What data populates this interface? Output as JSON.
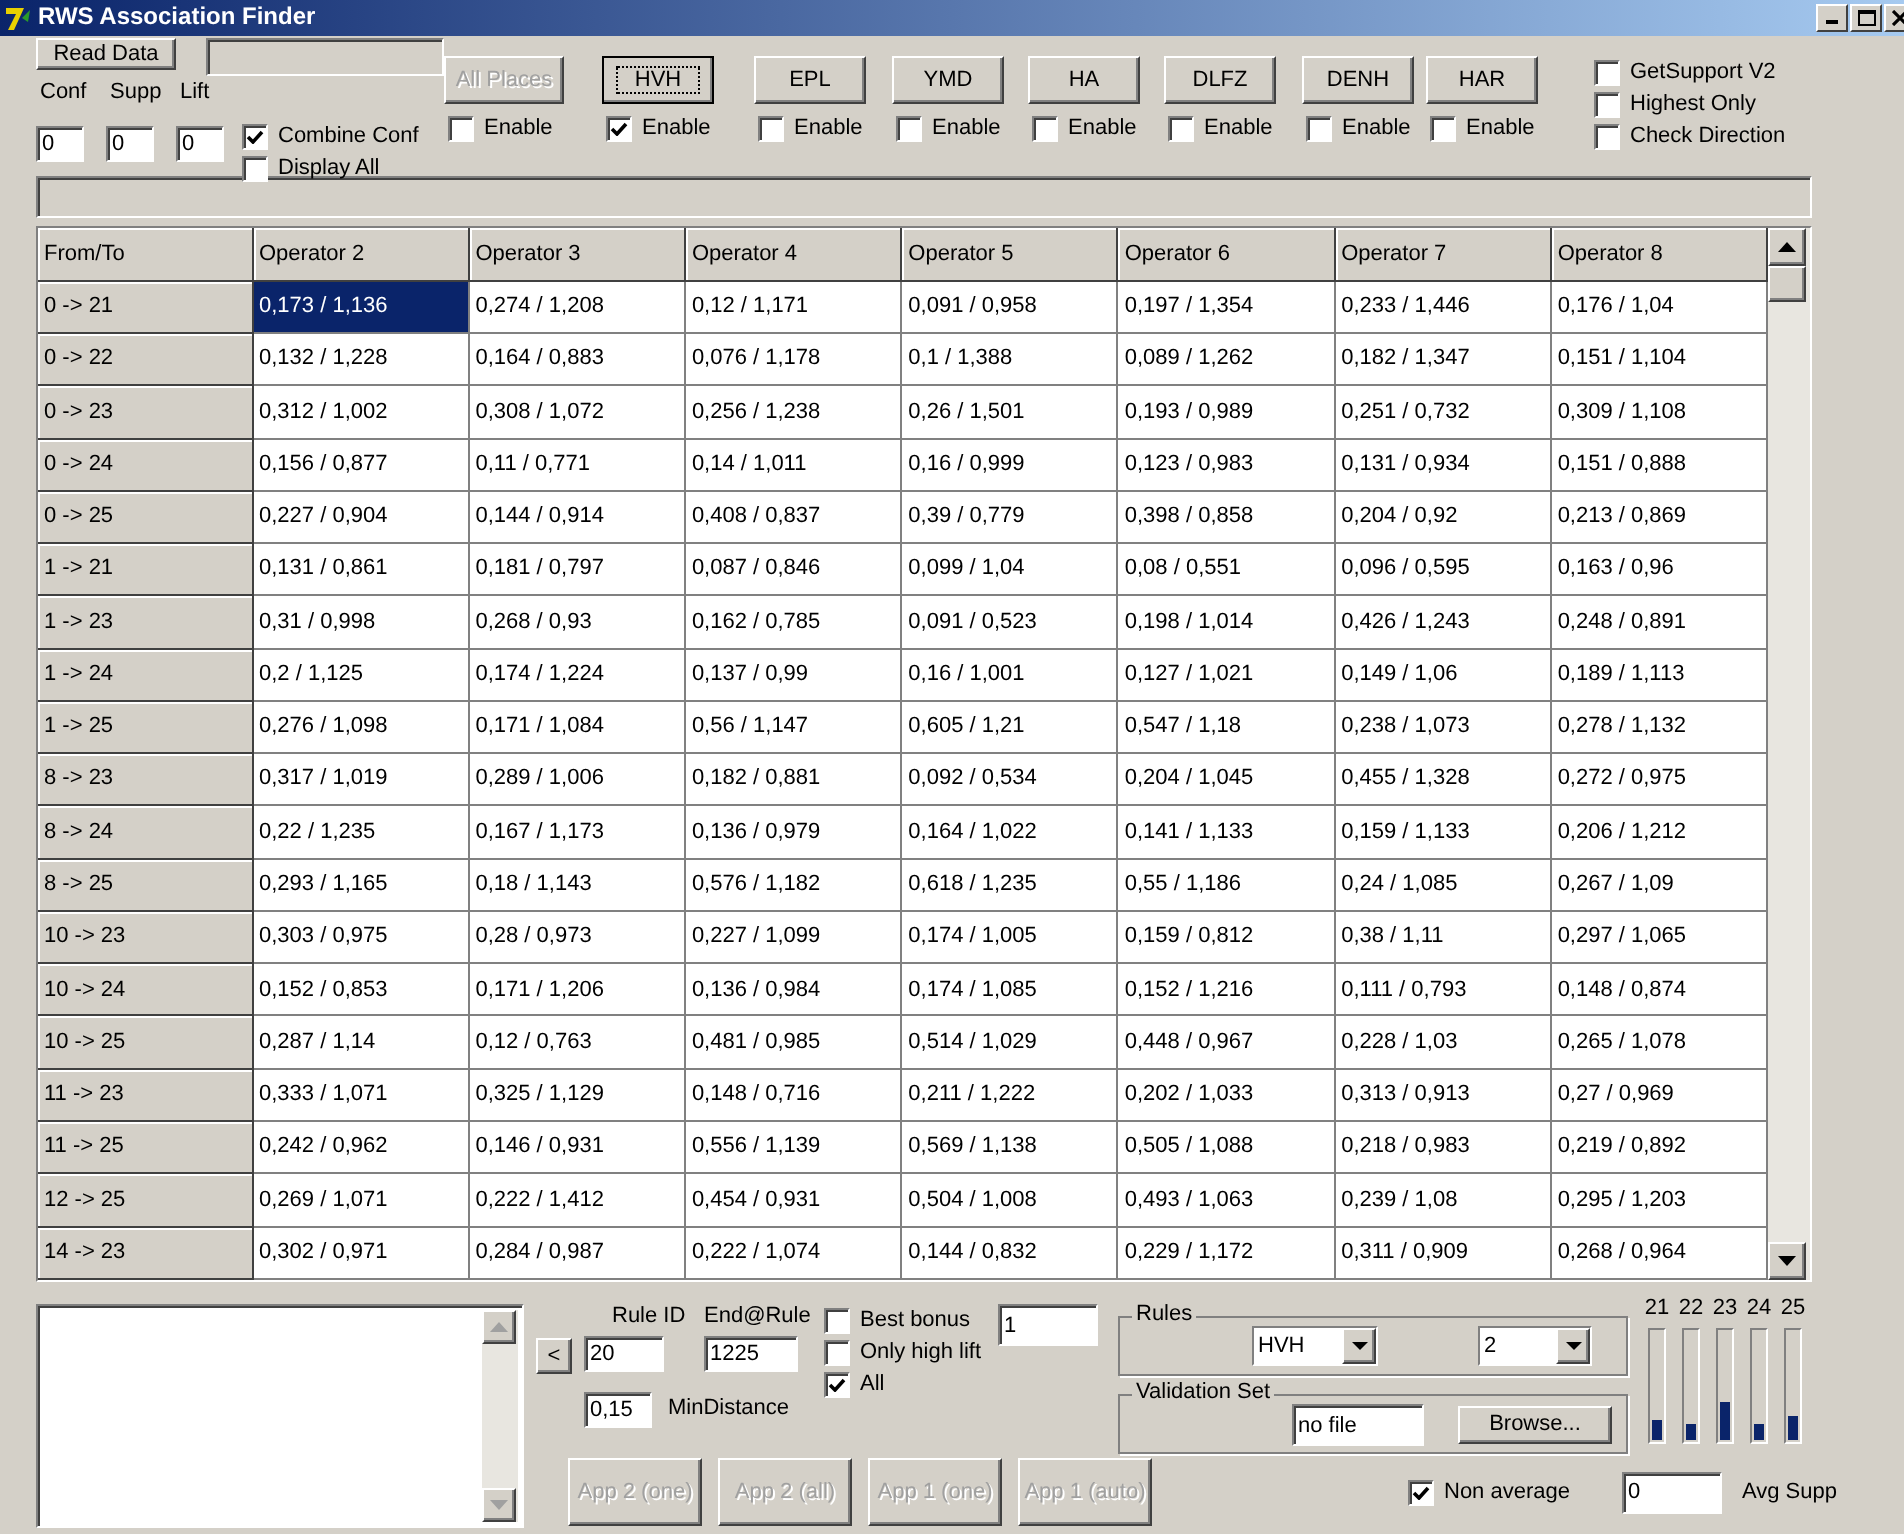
{
  "window": {
    "title": "RWS Association Finder"
  },
  "toolbar": {
    "read_button": "Read Data",
    "file_field": {
      "disabled": true
    },
    "thresholds": [
      {
        "label": "Conf",
        "value": "0"
      },
      {
        "label": "Supp",
        "value": "0"
      },
      {
        "label": "Lift",
        "value": "0"
      }
    ],
    "options": [
      {
        "label": "Combine Conf",
        "checked": true
      },
      {
        "label": "Display All",
        "checked": false
      }
    ],
    "places": [
      {
        "label": "All Places",
        "disabled": true,
        "focused": false,
        "enable_label": "Enable",
        "checked": false
      },
      {
        "label": "HVH",
        "disabled": false,
        "focused": true,
        "enable_label": "Enable",
        "checked": true
      },
      {
        "label": "EPL",
        "disabled": false,
        "focused": false,
        "enable_label": "Enable",
        "checked": false
      },
      {
        "label": "YMD",
        "disabled": false,
        "focused": false,
        "enable_label": "Enable",
        "checked": false
      },
      {
        "label": "HA",
        "disabled": false,
        "focused": false,
        "enable_label": "Enable",
        "checked": false
      },
      {
        "label": "DLFZ",
        "disabled": false,
        "focused": false,
        "enable_label": "Enable",
        "checked": false
      },
      {
        "label": "DENH",
        "disabled": false,
        "focused": false,
        "enable_label": "Enable",
        "checked": false
      },
      {
        "label": "HAR",
        "disabled": false,
        "focused": false,
        "enable_label": "Enable",
        "checked": false
      }
    ],
    "flags": [
      {
        "label": "GetSupport V2",
        "checked": false
      },
      {
        "label": "Highest Only",
        "checked": false
      },
      {
        "label": "Check Direction",
        "checked": false
      }
    ]
  },
  "table": {
    "row_header_title": "From/To",
    "columns": [
      "Operator 2",
      "Operator 3",
      "Operator 4",
      "Operator 5",
      "Operator 6",
      "Operator 7",
      "Operator 8"
    ],
    "rows": [
      {
        "head": "0 -> 21",
        "cells": [
          {
            "t": "0,173 / 1,136",
            "selected": true
          },
          {
            "t": "0,274 / 1,208",
            "selected": false
          },
          {
            "t": "0,12 / 1,171",
            "selected": false
          },
          {
            "t": "0,091 / 0,958",
            "selected": false
          },
          {
            "t": "0,197 / 1,354",
            "selected": false
          },
          {
            "t": "0,233 / 1,446",
            "selected": false
          },
          {
            "t": "0,176 / 1,04",
            "selected": false
          }
        ]
      },
      {
        "head": "0 -> 22",
        "cells": [
          {
            "t": "0,132 / 1,228",
            "selected": false
          },
          {
            "t": "0,164 / 0,883",
            "selected": false
          },
          {
            "t": "0,076 / 1,178",
            "selected": false
          },
          {
            "t": "0,1 / 1,388",
            "selected": false
          },
          {
            "t": "0,089 / 1,262",
            "selected": false
          },
          {
            "t": "0,182 / 1,347",
            "selected": false
          },
          {
            "t": "0,151 / 1,104",
            "selected": false
          }
        ]
      },
      {
        "head": "0 -> 23",
        "cells": [
          {
            "t": "0,312 / 1,002",
            "selected": false
          },
          {
            "t": "0,308 / 1,072",
            "selected": false
          },
          {
            "t": "0,256 / 1,238",
            "selected": false
          },
          {
            "t": "0,26 / 1,501",
            "selected": false
          },
          {
            "t": "0,193 / 0,989",
            "selected": false
          },
          {
            "t": "0,251 / 0,732",
            "selected": false
          },
          {
            "t": "0,309 / 1,108",
            "selected": false
          }
        ]
      },
      {
        "head": "0 -> 24",
        "cells": [
          {
            "t": "0,156 / 0,877",
            "selected": false
          },
          {
            "t": "0,11 / 0,771",
            "selected": false
          },
          {
            "t": "0,14 / 1,011",
            "selected": false
          },
          {
            "t": "0,16 / 0,999",
            "selected": false
          },
          {
            "t": "0,123 / 0,983",
            "selected": false
          },
          {
            "t": "0,131 / 0,934",
            "selected": false
          },
          {
            "t": "0,151 / 0,888",
            "selected": false
          }
        ]
      },
      {
        "head": "0 -> 25",
        "cells": [
          {
            "t": "0,227 / 0,904",
            "selected": false
          },
          {
            "t": "0,144 / 0,914",
            "selected": false
          },
          {
            "t": "0,408 / 0,837",
            "selected": false
          },
          {
            "t": "0,39 / 0,779",
            "selected": false
          },
          {
            "t": "0,398 / 0,858",
            "selected": false
          },
          {
            "t": "0,204 / 0,92",
            "selected": false
          },
          {
            "t": "0,213 / 0,869",
            "selected": false
          }
        ]
      },
      {
        "head": "1 -> 21",
        "cells": [
          {
            "t": "0,131 / 0,861",
            "selected": false
          },
          {
            "t": "0,181 / 0,797",
            "selected": false
          },
          {
            "t": "0,087 / 0,846",
            "selected": false
          },
          {
            "t": "0,099 / 1,04",
            "selected": false
          },
          {
            "t": "0,08 / 0,551",
            "selected": false
          },
          {
            "t": "0,096 / 0,595",
            "selected": false
          },
          {
            "t": "0,163 / 0,96",
            "selected": false
          }
        ]
      },
      {
        "head": "1 -> 23",
        "cells": [
          {
            "t": "0,31 / 0,998",
            "selected": false
          },
          {
            "t": "0,268 / 0,93",
            "selected": false
          },
          {
            "t": "0,162 / 0,785",
            "selected": false
          },
          {
            "t": "0,091 / 0,523",
            "selected": false
          },
          {
            "t": "0,198 / 1,014",
            "selected": false
          },
          {
            "t": "0,426 / 1,243",
            "selected": false
          },
          {
            "t": "0,248 / 0,891",
            "selected": false
          }
        ]
      },
      {
        "head": "1 -> 24",
        "cells": [
          {
            "t": "0,2 / 1,125",
            "selected": false
          },
          {
            "t": "0,174 / 1,224",
            "selected": false
          },
          {
            "t": "0,137 / 0,99",
            "selected": false
          },
          {
            "t": "0,16 / 1,001",
            "selected": false
          },
          {
            "t": "0,127 / 1,021",
            "selected": false
          },
          {
            "t": "0,149 / 1,06",
            "selected": false
          },
          {
            "t": "0,189 / 1,113",
            "selected": false
          }
        ]
      },
      {
        "head": "1 -> 25",
        "cells": [
          {
            "t": "0,276 / 1,098",
            "selected": false
          },
          {
            "t": "0,171 / 1,084",
            "selected": false
          },
          {
            "t": "0,56 / 1,147",
            "selected": false
          },
          {
            "t": "0,605 / 1,21",
            "selected": false
          },
          {
            "t": "0,547 / 1,18",
            "selected": false
          },
          {
            "t": "0,238 / 1,073",
            "selected": false
          },
          {
            "t": "0,278 / 1,132",
            "selected": false
          }
        ]
      },
      {
        "head": "8 -> 23",
        "cells": [
          {
            "t": "0,317 / 1,019",
            "selected": false
          },
          {
            "t": "0,289 / 1,006",
            "selected": false
          },
          {
            "t": "0,182 / 0,881",
            "selected": false
          },
          {
            "t": "0,092 / 0,534",
            "selected": false
          },
          {
            "t": "0,204 / 1,045",
            "selected": false
          },
          {
            "t": "0,455 / 1,328",
            "selected": false
          },
          {
            "t": "0,272 / 0,975",
            "selected": false
          }
        ]
      },
      {
        "head": "8 -> 24",
        "cells": [
          {
            "t": "0,22 / 1,235",
            "selected": false
          },
          {
            "t": "0,167 / 1,173",
            "selected": false
          },
          {
            "t": "0,136 / 0,979",
            "selected": false
          },
          {
            "t": "0,164 / 1,022",
            "selected": false
          },
          {
            "t": "0,141 / 1,133",
            "selected": false
          },
          {
            "t": "0,159 / 1,133",
            "selected": false
          },
          {
            "t": "0,206 / 1,212",
            "selected": false
          }
        ]
      },
      {
        "head": "8 -> 25",
        "cells": [
          {
            "t": "0,293 / 1,165",
            "selected": false
          },
          {
            "t": "0,18 / 1,143",
            "selected": false
          },
          {
            "t": "0,576 / 1,182",
            "selected": false
          },
          {
            "t": "0,618 / 1,235",
            "selected": false
          },
          {
            "t": "0,55 / 1,186",
            "selected": false
          },
          {
            "t": "0,24 / 1,085",
            "selected": false
          },
          {
            "t": "0,267 / 1,09",
            "selected": false
          }
        ]
      },
      {
        "head": "10 -> 23",
        "cells": [
          {
            "t": "0,303 / 0,975",
            "selected": false
          },
          {
            "t": "0,28 / 0,973",
            "selected": false
          },
          {
            "t": "0,227 / 1,099",
            "selected": false
          },
          {
            "t": "0,174 / 1,005",
            "selected": false
          },
          {
            "t": "0,159 / 0,812",
            "selected": false
          },
          {
            "t": "0,38 / 1,11",
            "selected": false
          },
          {
            "t": "0,297 / 1,065",
            "selected": false
          }
        ]
      },
      {
        "head": "10 -> 24",
        "cells": [
          {
            "t": "0,152 / 0,853",
            "selected": false
          },
          {
            "t": "0,171 / 1,206",
            "selected": false
          },
          {
            "t": "0,136 / 0,984",
            "selected": false
          },
          {
            "t": "0,174 / 1,085",
            "selected": false
          },
          {
            "t": "0,152 / 1,216",
            "selected": false
          },
          {
            "t": "0,111 / 0,793",
            "selected": false
          },
          {
            "t": "0,148 / 0,874",
            "selected": false
          }
        ]
      },
      {
        "head": "10 -> 25",
        "cells": [
          {
            "t": "0,287 / 1,14",
            "selected": false
          },
          {
            "t": "0,12 / 0,763",
            "selected": false
          },
          {
            "t": "0,481 / 0,985",
            "selected": false
          },
          {
            "t": "0,514 / 1,029",
            "selected": false
          },
          {
            "t": "0,448 / 0,967",
            "selected": false
          },
          {
            "t": "0,228 / 1,03",
            "selected": false
          },
          {
            "t": "0,265 / 1,078",
            "selected": false
          }
        ]
      },
      {
        "head": "11 -> 23",
        "cells": [
          {
            "t": "0,333 / 1,071",
            "selected": false
          },
          {
            "t": "0,325 / 1,129",
            "selected": false
          },
          {
            "t": "0,148 / 0,716",
            "selected": false
          },
          {
            "t": "0,211 / 1,222",
            "selected": false
          },
          {
            "t": "0,202 / 1,033",
            "selected": false
          },
          {
            "t": "0,313 / 0,913",
            "selected": false
          },
          {
            "t": "0,27 / 0,969",
            "selected": false
          }
        ]
      },
      {
        "head": "11 -> 25",
        "cells": [
          {
            "t": "0,242 / 0,962",
            "selected": false
          },
          {
            "t": "0,146 / 0,931",
            "selected": false
          },
          {
            "t": "0,556 / 1,139",
            "selected": false
          },
          {
            "t": "0,569 / 1,138",
            "selected": false
          },
          {
            "t": "0,505 / 1,088",
            "selected": false
          },
          {
            "t": "0,218 / 0,983",
            "selected": false
          },
          {
            "t": "0,219 / 0,892",
            "selected": false
          }
        ]
      },
      {
        "head": "12 -> 25",
        "cells": [
          {
            "t": "0,269 / 1,071",
            "selected": false
          },
          {
            "t": "0,222 / 1,412",
            "selected": false
          },
          {
            "t": "0,454 / 0,931",
            "selected": false
          },
          {
            "t": "0,504 / 1,008",
            "selected": false
          },
          {
            "t": "0,493 / 1,063",
            "selected": false
          },
          {
            "t": "0,239 / 1,08",
            "selected": false
          },
          {
            "t": "0,295 / 1,203",
            "selected": false
          }
        ]
      },
      {
        "head": "14 -> 23",
        "cells": [
          {
            "t": "0,302 / 0,971",
            "selected": false
          },
          {
            "t": "0,284 / 0,987",
            "selected": false
          },
          {
            "t": "0,222 / 1,074",
            "selected": false
          },
          {
            "t": "0,144 / 0,832",
            "selected": false
          },
          {
            "t": "0,229 / 1,172",
            "selected": false
          },
          {
            "t": "0,311 / 0,909",
            "selected": false
          },
          {
            "t": "0,268 / 0,964",
            "selected": false
          }
        ]
      }
    ]
  },
  "bottom": {
    "prev_button": "<",
    "rule_id": {
      "label": "Rule ID",
      "value": "20"
    },
    "end_rule": {
      "label": "End@Rule",
      "value": "1225"
    },
    "min_distance": {
      "label": "MinDistance",
      "value": "0,15"
    },
    "filters": [
      {
        "label": "Best bonus",
        "checked": false
      },
      {
        "label": "Only high lift",
        "checked": false
      },
      {
        "label": "All",
        "checked": true
      }
    ],
    "bonus_value": "1",
    "rules": {
      "title": "Rules",
      "place": "HVH",
      "count": "2"
    },
    "validation": {
      "title": "Validation Set",
      "file": "no file",
      "browse": "Browse..."
    },
    "meters": [
      {
        "label": "21",
        "level": 0.17
      },
      {
        "label": "22",
        "level": 0.14
      },
      {
        "label": "23",
        "level": 0.35
      },
      {
        "label": "24",
        "level": 0.14
      },
      {
        "label": "25",
        "level": 0.22
      }
    ],
    "apps": [
      {
        "label": "App 2 (one)",
        "disabled": true
      },
      {
        "label": "App 2 (all)",
        "disabled": true
      },
      {
        "label": "App 1 (one)",
        "disabled": true
      },
      {
        "label": "App 1 (auto)",
        "disabled": true
      }
    ],
    "non_average": {
      "label": "Non average",
      "checked": true
    },
    "avg_supp": {
      "label": "Avg Supp",
      "value": "0"
    }
  }
}
